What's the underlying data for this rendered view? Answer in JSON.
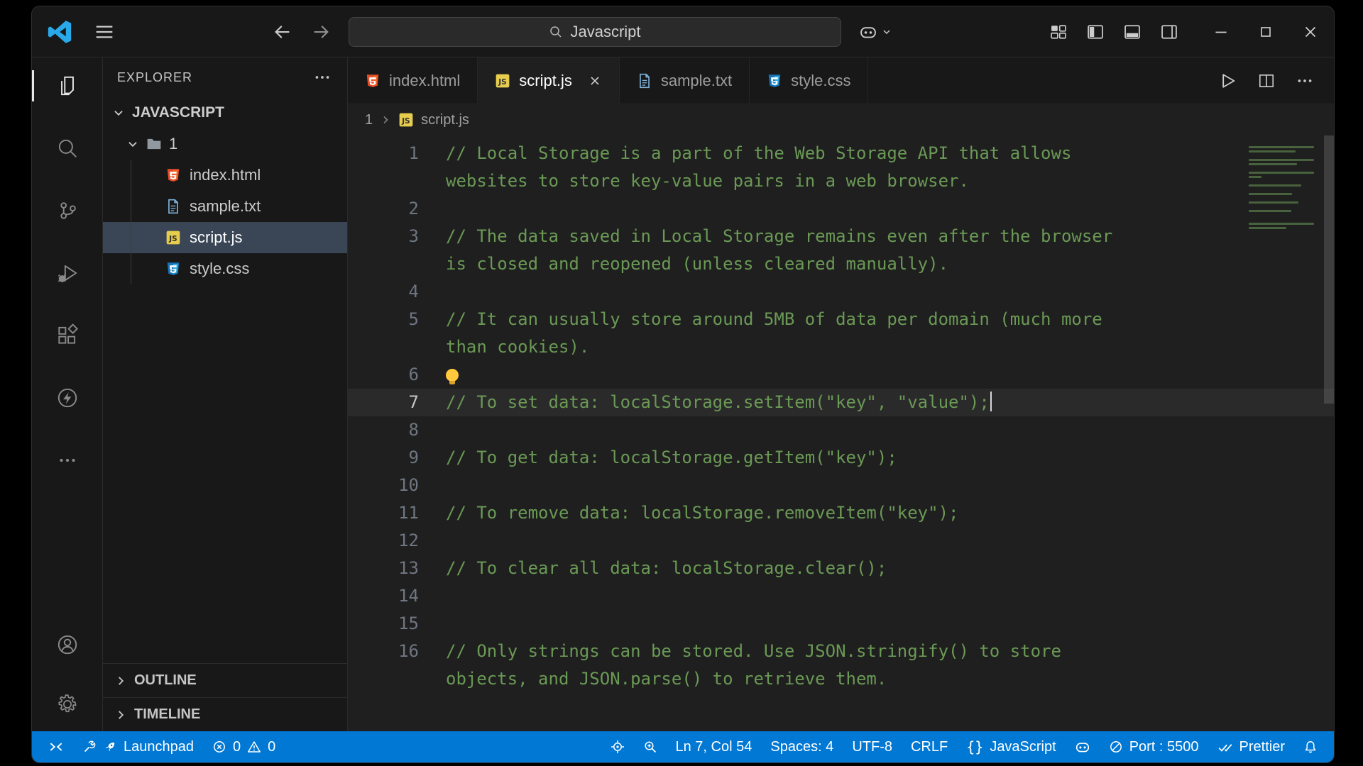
{
  "titlebar": {
    "search_value": "Javascript"
  },
  "sidebar": {
    "header": "EXPLORER",
    "workspace": "JAVASCRIPT",
    "folder": "1",
    "files": [
      {
        "name": "index.html",
        "type": "html",
        "selected": false
      },
      {
        "name": "sample.txt",
        "type": "txt",
        "selected": false
      },
      {
        "name": "script.js",
        "type": "js",
        "selected": true
      },
      {
        "name": "style.css",
        "type": "css",
        "selected": false
      }
    ],
    "sections": [
      {
        "label": "OUTLINE"
      },
      {
        "label": "TIMELINE"
      }
    ]
  },
  "tabs": [
    {
      "label": "index.html",
      "type": "html",
      "active": false
    },
    {
      "label": "script.js",
      "type": "js",
      "active": true
    },
    {
      "label": "sample.txt",
      "type": "txt",
      "active": false
    },
    {
      "label": "style.css",
      "type": "css",
      "active": false
    }
  ],
  "breadcrumb": {
    "folder": "1",
    "file": "script.js",
    "file_type": "js"
  },
  "editor": {
    "current_line": 7,
    "lightbulb_line": 6,
    "cursor": {
      "line": 7,
      "col": 54
    },
    "lines": [
      "// Local Storage is a part of the Web Storage API that allows websites to store key-value pairs in a web browser.",
      "",
      "// The data saved in Local Storage remains even after the browser is closed and reopened (unless cleared manually).",
      "",
      "// It can usually store around 5MB of data per domain (much more than cookies).",
      "",
      "// To set data: localStorage.setItem(\"key\", \"value\");",
      "",
      "// To get data: localStorage.getItem(\"key\");",
      "",
      "// To remove data: localStorage.removeItem(\"key\");",
      "",
      "// To clear all data: localStorage.clear();",
      "",
      "",
      "// Only strings can be stored. Use JSON.stringify() to store objects, and JSON.parse() to retrieve them."
    ]
  },
  "statusbar": {
    "left": [
      {
        "name": "remote-button",
        "parts": [
          {
            "icon": "remote-icon"
          }
        ]
      },
      {
        "name": "launchpad-button",
        "parts": [
          {
            "icon": "wrench-icon"
          },
          {
            "icon": "rocket-icon"
          },
          {
            "text": "Launchpad"
          }
        ]
      },
      {
        "name": "problems-button",
        "parts": [
          {
            "icon": "error-icon"
          },
          {
            "text": "0"
          },
          {
            "icon": "warning-icon"
          },
          {
            "text": "0"
          }
        ]
      }
    ],
    "right": [
      {
        "name": "target-button",
        "parts": [
          {
            "icon": "target-icon"
          }
        ]
      },
      {
        "name": "zoom-button",
        "parts": [
          {
            "icon": "zoom-in-icon"
          }
        ]
      },
      {
        "name": "cursor-position-button",
        "parts": [
          {
            "text": "Ln 7, Col 54"
          }
        ]
      },
      {
        "name": "indentation-button",
        "parts": [
          {
            "text": "Spaces: 4"
          }
        ]
      },
      {
        "name": "encoding-button",
        "parts": [
          {
            "text": "UTF-8"
          }
        ]
      },
      {
        "name": "eol-button",
        "parts": [
          {
            "text": "CRLF"
          }
        ]
      },
      {
        "name": "language-mode-button",
        "parts": [
          {
            "icon": "braces-icon"
          },
          {
            "text": "JavaScript"
          }
        ]
      },
      {
        "name": "copilot-status-button",
        "parts": [
          {
            "icon": "copilot-icon"
          }
        ]
      },
      {
        "name": "port-button",
        "parts": [
          {
            "icon": "circle-slash-icon"
          },
          {
            "text": "Port : 5500"
          }
        ]
      },
      {
        "name": "prettier-button",
        "parts": [
          {
            "icon": "double-check-icon"
          },
          {
            "text": "Prettier"
          }
        ]
      },
      {
        "name": "notifications-button",
        "parts": [
          {
            "icon": "bell-icon"
          }
        ]
      }
    ]
  },
  "colors": {
    "statusbar_bg": "#0078d4",
    "comment_green": "#6a9955",
    "editor_bg": "#1f1f1f",
    "chrome_bg": "#181818",
    "selected_row": "#3a4656",
    "html_icon": "#e44d26",
    "css_icon": "#1572b6",
    "js_icon": "#e6cd4e"
  }
}
